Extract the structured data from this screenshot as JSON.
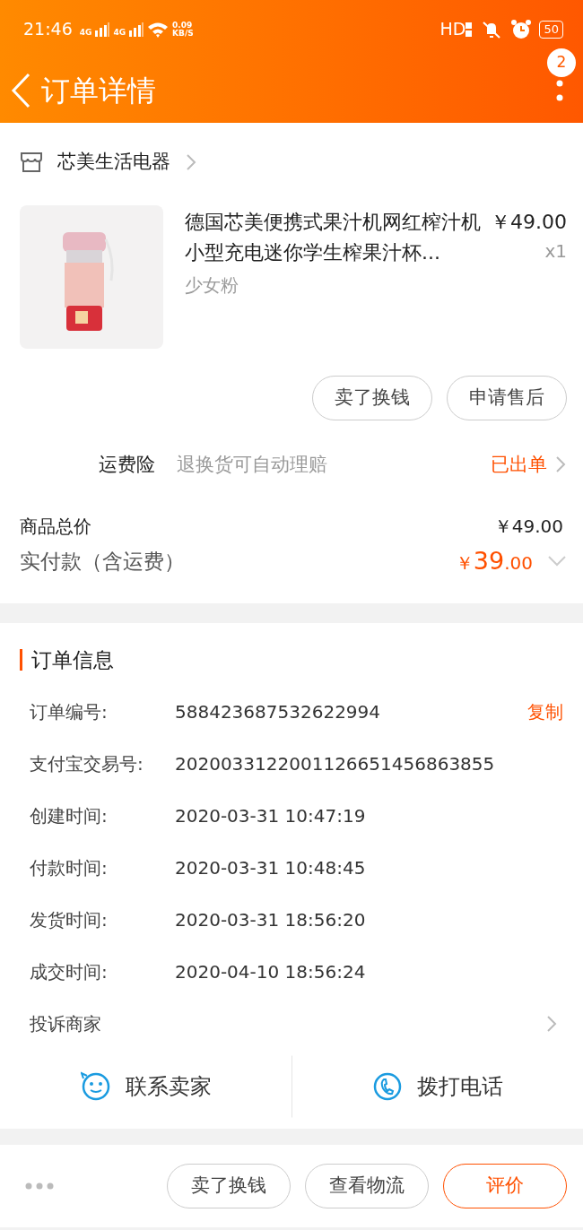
{
  "status_bar": {
    "time": "21:46",
    "networks": [
      "4G",
      "4G"
    ],
    "speed": "0.09",
    "speed_unit": "KB/S",
    "hd": "HD",
    "battery": "50"
  },
  "header": {
    "title": "订单详情",
    "badge": "2"
  },
  "shop": {
    "name": "芯美生活电器"
  },
  "product": {
    "kind": "picture",
    "title": "德国芯美便携式果汁机网红榨汁机小型充电迷你学生榨果汁杯...",
    "variant": "少女粉",
    "price": "￥49.00",
    "quantity": "x1"
  },
  "item_actions": [
    "卖了换钱",
    "申请售后"
  ],
  "insurance": {
    "label": "运费险",
    "description": "退换货可自动理赔",
    "status": "已出单"
  },
  "totals": {
    "goods_label": "商品总价",
    "goods_value": "￥49.00",
    "paid_label": "实付款（含运费）",
    "paid_currency": "￥",
    "paid_integer": "39",
    "paid_decimal": ".00"
  },
  "order_info": {
    "title": "订单信息",
    "rows": [
      {
        "label": "订单编号:",
        "value": "588423687532622994",
        "action": "复制"
      },
      {
        "label": "支付宝交易号:",
        "value": "2020033122001126651456863855"
      },
      {
        "label": "创建时间:",
        "value": "2020-03-31 10:47:19"
      },
      {
        "label": "付款时间:",
        "value": "2020-03-31 10:48:45"
      },
      {
        "label": "发货时间:",
        "value": "2020-03-31 18:56:20"
      },
      {
        "label": "成交时间:",
        "value": "2020-04-10 18:56:24"
      }
    ],
    "complaint": "投诉商家"
  },
  "contacts": [
    {
      "kind": "chat",
      "label": "联系卖家"
    },
    {
      "kind": "phone",
      "label": "拨打电话"
    }
  ],
  "bottom_actions": [
    {
      "label": "卖了换钱",
      "primary": false
    },
    {
      "label": "查看物流",
      "primary": false
    },
    {
      "label": "评价",
      "primary": true
    }
  ]
}
